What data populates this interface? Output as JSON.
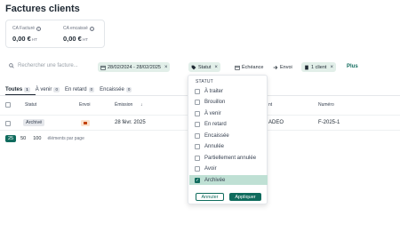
{
  "page": {
    "title": "Factures clients"
  },
  "kpis": [
    {
      "label": "CA Facturé",
      "value": "0,00 €",
      "unit": "HT"
    },
    {
      "label": "CA encaissé",
      "value": "0,00 €",
      "unit": "HT"
    }
  ],
  "filters": {
    "search_placeholder": "Rechercher une facture...",
    "date_range": "28/02/2024 - 28/02/2025",
    "statut": "Statut",
    "echeance": "Échéance",
    "envoi": "Envoi",
    "client": "1 client",
    "plus": "Plus"
  },
  "tabs": [
    {
      "label": "Toutes",
      "count": "1"
    },
    {
      "label": "À venir",
      "count": "0"
    },
    {
      "label": "En retard",
      "count": "0"
    },
    {
      "label": "Encaissée",
      "count": "0"
    }
  ],
  "table": {
    "headers": {
      "statut": "Statut",
      "envoi": "Envoi",
      "emission": "Émission",
      "client": "nt",
      "numero": "Numéro"
    },
    "rows": [
      {
        "statut": "Archivé",
        "emission": "28 févr. 2025",
        "client": "ADEO",
        "numero": "F-2025-1"
      }
    ]
  },
  "pagination": {
    "sizes": [
      "25",
      "50",
      "100"
    ],
    "label": "éléments par page"
  },
  "dropdown": {
    "header": "STATUT",
    "options": [
      "À traiter",
      "Brouillon",
      "À venir",
      "En retard",
      "Encaissée",
      "Annulée",
      "Partiellement annulée",
      "Avoir",
      "Archivée"
    ],
    "cancel": "Annuler",
    "apply": "Appliquer"
  },
  "colors": {
    "accent": "#0f6b5d",
    "selected_bg": "#bfe0d4",
    "chip_bg": "#e2efe9"
  }
}
